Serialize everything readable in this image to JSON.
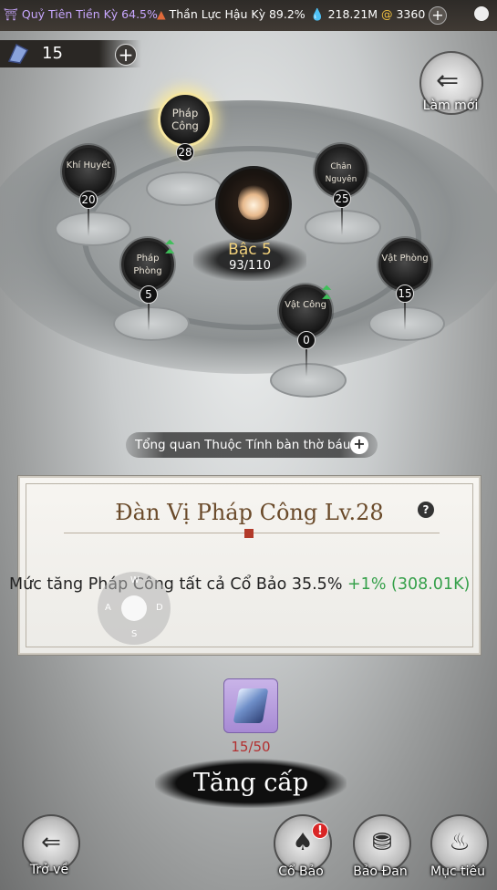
{
  "top_bar": {
    "realm1": "Quỷ Tiên Tiền Kỳ 64.5%",
    "realm2": "Thần Lực Hậu Kỳ 89.2%",
    "water_amount": "218.21M",
    "gold_amount": "3360",
    "plus_label": "+"
  },
  "currency": {
    "crystal_count": "15",
    "plus_label": "+"
  },
  "refresh": {
    "label": "Làm mới"
  },
  "nodes": [
    {
      "name": "Pháp Công",
      "level": "28"
    },
    {
      "name": "Khí Huyết",
      "level": "20"
    },
    {
      "name": "Chân Nguyên",
      "level": "25"
    },
    {
      "name": "Pháp Phòng",
      "level": "5"
    },
    {
      "name": "Vật Phòng",
      "level": "15"
    },
    {
      "name": "Vật Công",
      "level": "0"
    }
  ],
  "center": {
    "rank": "Bậc 5",
    "progress": "93/110"
  },
  "overview": {
    "label": "Tổng quan Thuộc Tính bàn thờ báu",
    "plus_label": "+"
  },
  "panel": {
    "title": "Đàn Vị Pháp Công  Lv.28",
    "help": "?",
    "effect_text": "Mức tăng Pháp Công tất cả Cổ Bảo 35.5% ",
    "effect_bonus": "+1% (308.01K)"
  },
  "joystick": {
    "n": "W",
    "w": "A",
    "e": "D",
    "s": "S"
  },
  "material": {
    "count": "15/50"
  },
  "upgrade": {
    "label": "Tăng cấp"
  },
  "bottom_nav": {
    "back": "Trở về",
    "co_bao": "Cổ Bảo",
    "bao_dan": "Bảo Đan",
    "muc_tieu": "Mục tiêu",
    "badge": "!"
  },
  "colors": {
    "accent_gold": "#f2d27c",
    "bonus_green": "#35a04a",
    "count_red": "#b23030",
    "realm_purple": "#c8a7ff"
  }
}
